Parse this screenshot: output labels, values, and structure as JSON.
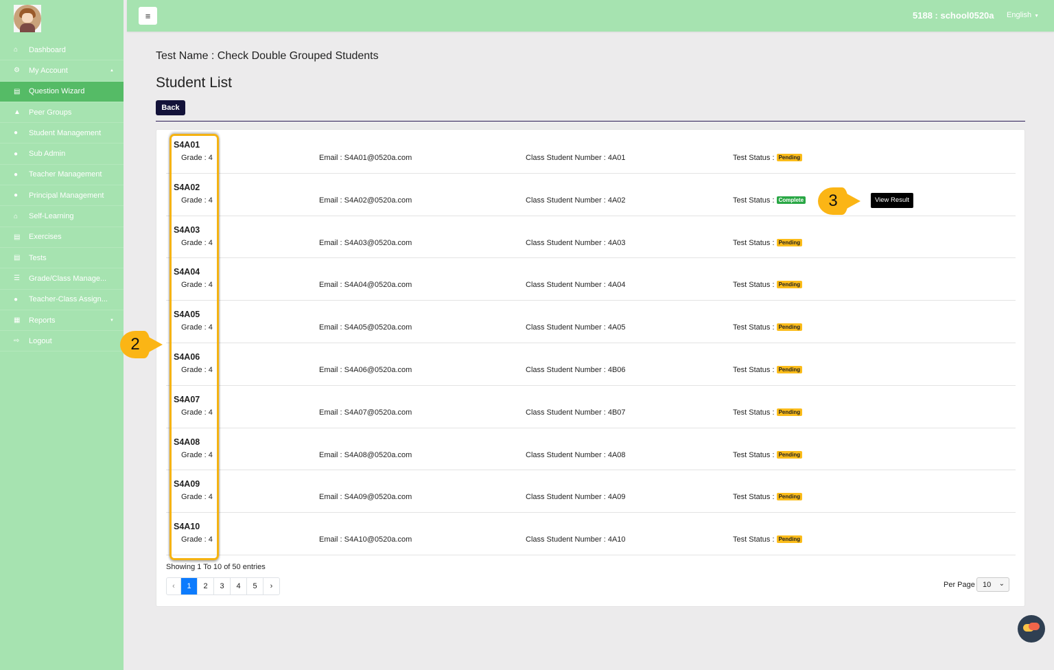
{
  "sidebar": {
    "items": [
      {
        "label": "Dashboard",
        "icon": "home-icon",
        "glyph": "⌂"
      },
      {
        "label": "My Account",
        "icon": "cogs-icon",
        "glyph": "⚙",
        "caret": "▲"
      },
      {
        "label": "Question Wizard",
        "icon": "book-icon",
        "glyph": "▤",
        "active": true
      },
      {
        "label": "Peer Groups",
        "icon": "user-icon",
        "glyph": "▲"
      },
      {
        "label": "Student Management",
        "icon": "users-icon",
        "glyph": "●"
      },
      {
        "label": "Sub Admin",
        "icon": "users-icon",
        "glyph": "●"
      },
      {
        "label": "Teacher Management",
        "icon": "users-icon",
        "glyph": "●"
      },
      {
        "label": "Principal Management",
        "icon": "users-icon",
        "glyph": "●"
      },
      {
        "label": "Self-Learning",
        "icon": "home-icon",
        "glyph": "⌂"
      },
      {
        "label": "Exercises",
        "icon": "book-icon",
        "glyph": "▤"
      },
      {
        "label": "Tests",
        "icon": "book-icon",
        "glyph": "▤"
      },
      {
        "label": "Grade/Class Manage...",
        "icon": "list-icon",
        "glyph": "☰"
      },
      {
        "label": "Teacher-Class Assign...",
        "icon": "users-icon",
        "glyph": "●"
      },
      {
        "label": "Reports",
        "icon": "table-icon",
        "glyph": "▦",
        "caret": "▼"
      },
      {
        "label": "Logout",
        "icon": "sign-out-icon",
        "glyph": "⇨"
      }
    ]
  },
  "topbar": {
    "menu_glyph": "≡",
    "user": "5188 : school0520a",
    "language": "English",
    "language_caret": "▼"
  },
  "main": {
    "test_name": "Test Name : Check Double Grouped Students",
    "title": "Student List",
    "back_label": "Back"
  },
  "students": [
    {
      "id": "S4A01",
      "grade": "Grade : 4",
      "email": "Email : S4A01@0520a.com",
      "csn": "Class Student Number : 4A01",
      "status_label": "Test Status :",
      "status": "Pending"
    },
    {
      "id": "S4A02",
      "grade": "Grade : 4",
      "email": "Email : S4A02@0520a.com",
      "csn": "Class Student Number : 4A02",
      "status_label": "Test Status :",
      "status": "Complete",
      "action": "View Result"
    },
    {
      "id": "S4A03",
      "grade": "Grade : 4",
      "email": "Email : S4A03@0520a.com",
      "csn": "Class Student Number : 4A03",
      "status_label": "Test Status :",
      "status": "Pending"
    },
    {
      "id": "S4A04",
      "grade": "Grade : 4",
      "email": "Email : S4A04@0520a.com",
      "csn": "Class Student Number : 4A04",
      "status_label": "Test Status :",
      "status": "Pending"
    },
    {
      "id": "S4A05",
      "grade": "Grade : 4",
      "email": "Email : S4A05@0520a.com",
      "csn": "Class Student Number : 4A05",
      "status_label": "Test Status :",
      "status": "Pending"
    },
    {
      "id": "S4A06",
      "grade": "Grade : 4",
      "email": "Email : S4A06@0520a.com",
      "csn": "Class Student Number : 4B06",
      "status_label": "Test Status :",
      "status": "Pending"
    },
    {
      "id": "S4A07",
      "grade": "Grade : 4",
      "email": "Email : S4A07@0520a.com",
      "csn": "Class Student Number : 4B07",
      "status_label": "Test Status :",
      "status": "Pending"
    },
    {
      "id": "S4A08",
      "grade": "Grade : 4",
      "email": "Email : S4A08@0520a.com",
      "csn": "Class Student Number : 4A08",
      "status_label": "Test Status :",
      "status": "Pending"
    },
    {
      "id": "S4A09",
      "grade": "Grade : 4",
      "email": "Email : S4A09@0520a.com",
      "csn": "Class Student Number : 4A09",
      "status_label": "Test Status :",
      "status": "Pending"
    },
    {
      "id": "S4A10",
      "grade": "Grade : 4",
      "email": "Email : S4A10@0520a.com",
      "csn": "Class Student Number : 4A10",
      "status_label": "Test Status :",
      "status": "Pending"
    }
  ],
  "pagination": {
    "summary": "Showing 1 To 10 of 50 entries",
    "prev": "‹",
    "next": "›",
    "pages": [
      "1",
      "2",
      "3",
      "4",
      "5"
    ],
    "current": "1",
    "per_page_label": "Per Page",
    "per_page_value": "10",
    "per_page_chevron": "⌄"
  },
  "annotations": {
    "marker_2": "2",
    "marker_3": "3",
    "accent": "#fbb515"
  },
  "colors": {
    "sidebar": "#a6e3b0",
    "sidebar_active": "#55bb66",
    "pending": "#fbbc1a",
    "complete": "#29a745",
    "primary": "#0d7bfd",
    "back_button": "#131239"
  }
}
